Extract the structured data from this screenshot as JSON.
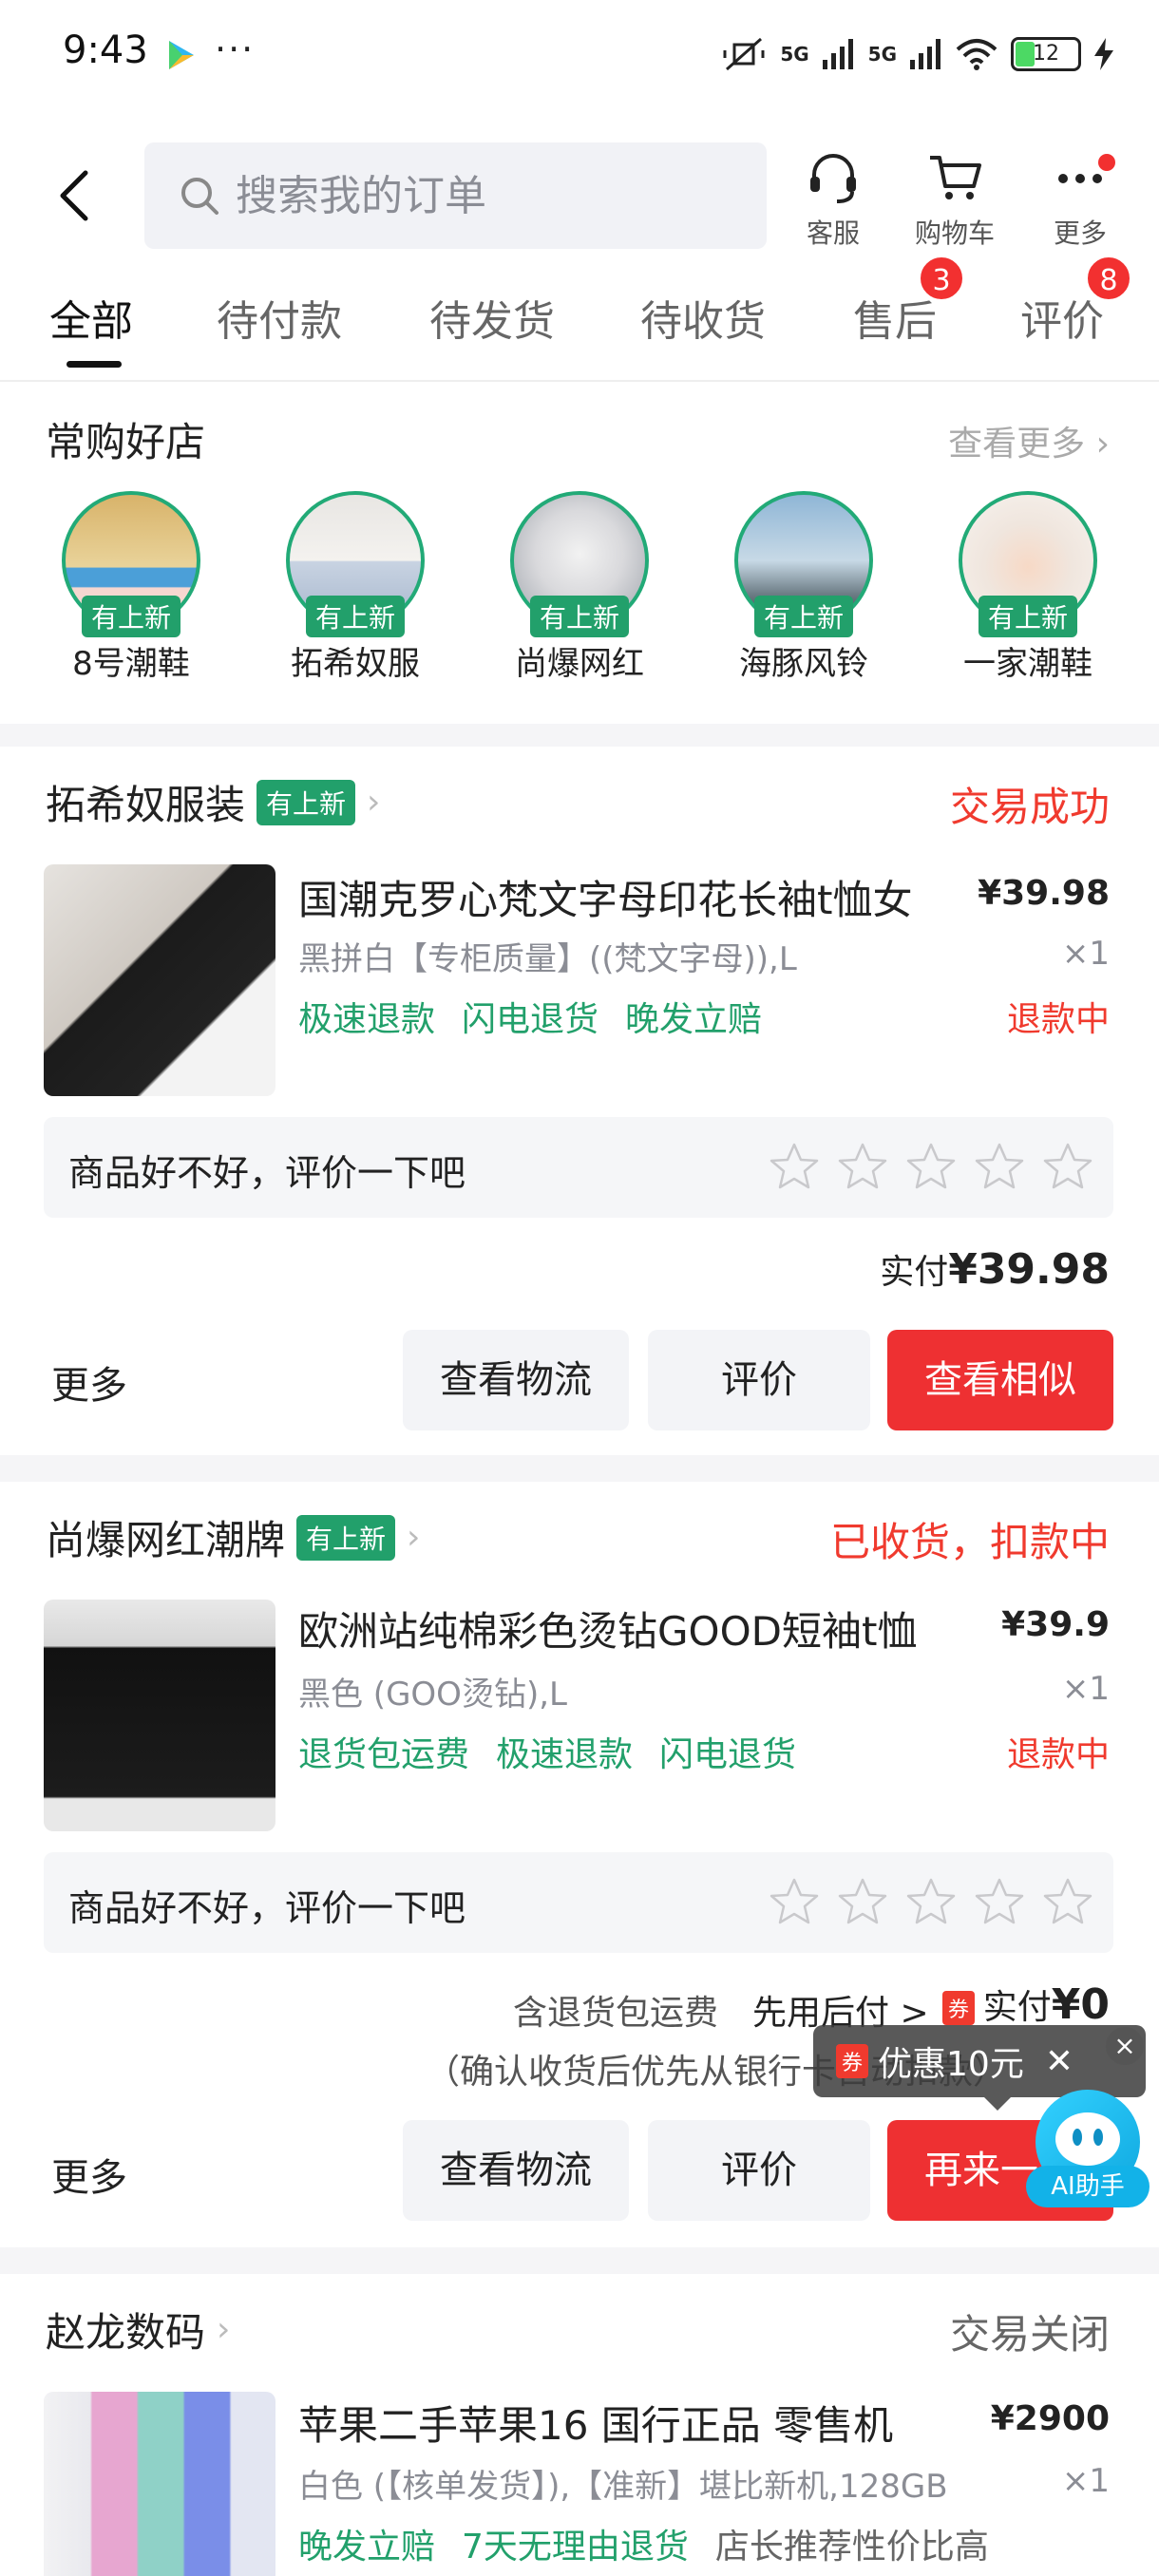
{
  "status": {
    "time": "9:43",
    "dots": "···",
    "net1": "5G",
    "net2": "5G",
    "battery": "12"
  },
  "search": {
    "placeholder": "搜索我的订单"
  },
  "toolbar": {
    "service": "客服",
    "cart": "购物车",
    "more": "更多"
  },
  "tabs": [
    {
      "label": "全部",
      "active": true
    },
    {
      "label": "待付款"
    },
    {
      "label": "待发货"
    },
    {
      "label": "待收货"
    },
    {
      "label": "售后",
      "badge": "3"
    },
    {
      "label": "评价",
      "badge": "8"
    }
  ],
  "fav_shops": {
    "title": "常购好店",
    "see_more": "查看更多",
    "new_tag": "有上新",
    "shops": [
      {
        "name": "8号潮鞋"
      },
      {
        "name": "拓希奴服"
      },
      {
        "name": "尚爆网红"
      },
      {
        "name": "海豚风铃"
      },
      {
        "name": "一家潮鞋"
      }
    ]
  },
  "orders": [
    {
      "store": "拓希奴服装",
      "tag": "有上新",
      "status": "交易成功",
      "title": "国潮克罗心梵文字母印花长袖t恤女",
      "price": "¥39.98",
      "spec": "黑拼白【专柜质量】((梵文字母)),L",
      "qty": "×1",
      "tags": [
        "极速退款",
        "闪电退货",
        "晚发立赔"
      ],
      "refund": "退款中",
      "rate_prompt": "商品好不好，评价一下吧",
      "paid_label": "实付",
      "paid_value": "¥39.98",
      "more": "更多",
      "buttons": [
        "查看物流",
        "评价",
        "查看相似"
      ]
    },
    {
      "store": "尚爆网红潮牌",
      "tag": "有上新",
      "status": "已收货，扣款中",
      "title": "欧洲站纯棉彩色烫钻GOOD短袖t恤",
      "price": "¥39.9",
      "spec": "黑色 (GOO烫钻),L",
      "qty": "×1",
      "tags": [
        "退货包运费",
        "极速退款",
        "闪电退货"
      ],
      "refund": "退款中",
      "rate_prompt": "商品好不好，评价一下吧",
      "note1": "含退货包运费",
      "note2": "先用后付 >",
      "coupon_mark": "券",
      "paid_label": "实付",
      "paid_value": "¥0",
      "note3": "（确认收货后优先从银行卡自动扣款）",
      "more": "更多",
      "buttons": [
        "查看物流",
        "评价",
        "再来一单"
      ]
    },
    {
      "store": "赵龙数码",
      "status": "交易关闭",
      "title": "苹果二手苹果16 国行正品 零售机",
      "price": "¥2900",
      "spec": "白色 (【核单发货】),【准新】堪比新机,128GB",
      "qty": "×1",
      "tags": [
        "晚发立赔",
        "7天无理由退货"
      ],
      "extra_tag": "店长推荐性价比高"
    }
  ],
  "popup": {
    "coupon": "券",
    "text": "优惠10元",
    "close": "✕"
  },
  "ai": {
    "label": "AI助手"
  },
  "colors": {
    "red": "#ee3032",
    "green": "#22a06b",
    "bg": "#f5f5f7"
  }
}
